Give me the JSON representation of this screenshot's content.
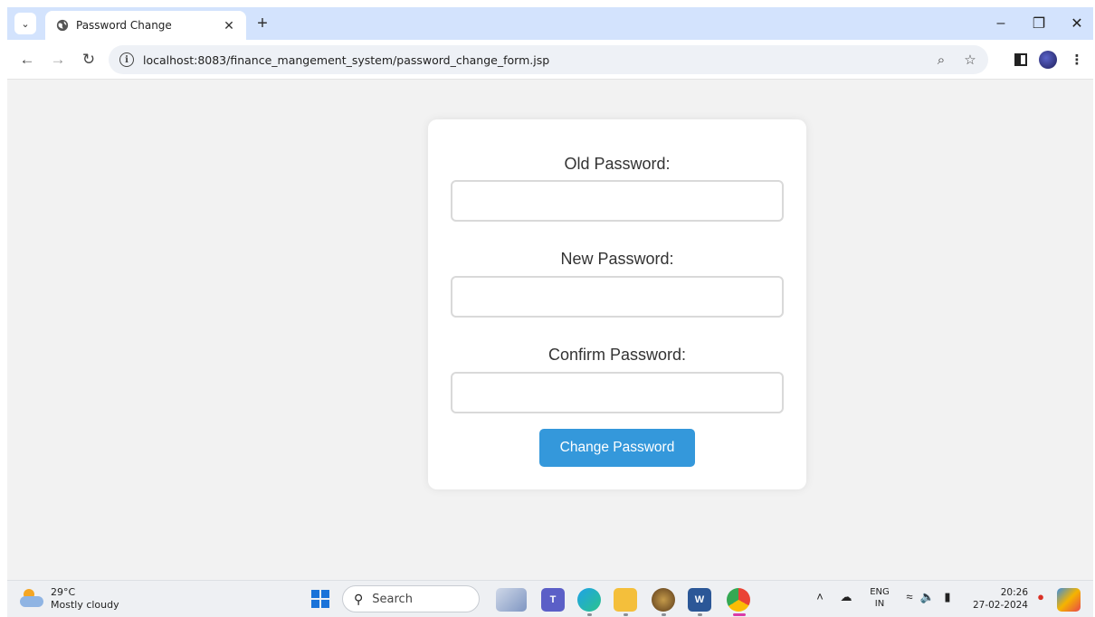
{
  "browser": {
    "tab_title": "Password Change",
    "url": "localhost:8083/finance_mangement_system/password_change_form.jsp"
  },
  "form": {
    "old_label": "Old Password:",
    "new_label": "New Password:",
    "confirm_label": "Confirm Password:",
    "old_value": "",
    "new_value": "",
    "confirm_value": "",
    "submit_label": "Change Password",
    "button_color": "#3498db"
  },
  "taskbar": {
    "temperature": "29°C",
    "weather": "Mostly cloudy",
    "search_placeholder": "Search",
    "lang_top": "ENG",
    "lang_bottom": "IN",
    "time": "20:26",
    "date": "27-02-2024"
  }
}
